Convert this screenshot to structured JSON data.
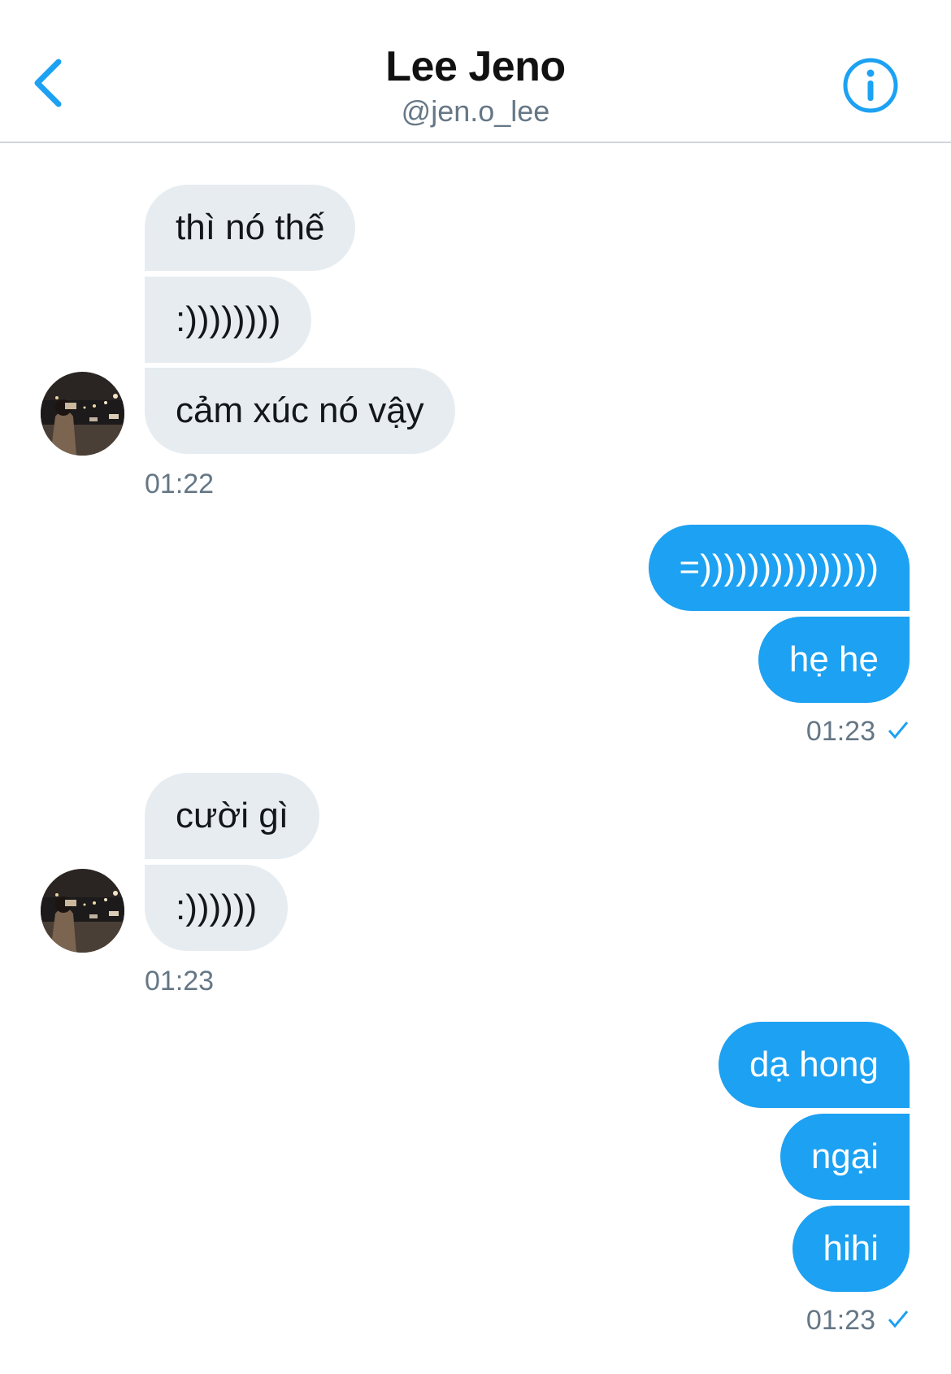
{
  "header": {
    "title": "Lee Jeno",
    "handle": "@jen.o_lee",
    "back_icon": "chevron-left-icon",
    "info_icon": "info-icon",
    "accent_color": "#1da1f2"
  },
  "groups": [
    {
      "direction": "incoming",
      "messages": [
        "thì nó thế",
        ":))))))))",
        "cảm xúc nó vậy"
      ],
      "time": "01:22"
    },
    {
      "direction": "outgoing",
      "messages": [
        "=)))))))))))))))",
        "hẹ hẹ"
      ],
      "time": "01:23",
      "status_icon": "check-icon"
    },
    {
      "direction": "incoming",
      "messages": [
        "cười gì",
        ":))))))"
      ],
      "time": "01:23"
    },
    {
      "direction": "outgoing",
      "messages": [
        "dạ hong",
        "ngại",
        "hihi"
      ],
      "time": "01:23",
      "status_icon": "check-icon"
    }
  ],
  "colors": {
    "incoming_bubble": "#e6ecf0",
    "outgoing_bubble": "#1da1f2",
    "timestamp": "#657786"
  }
}
